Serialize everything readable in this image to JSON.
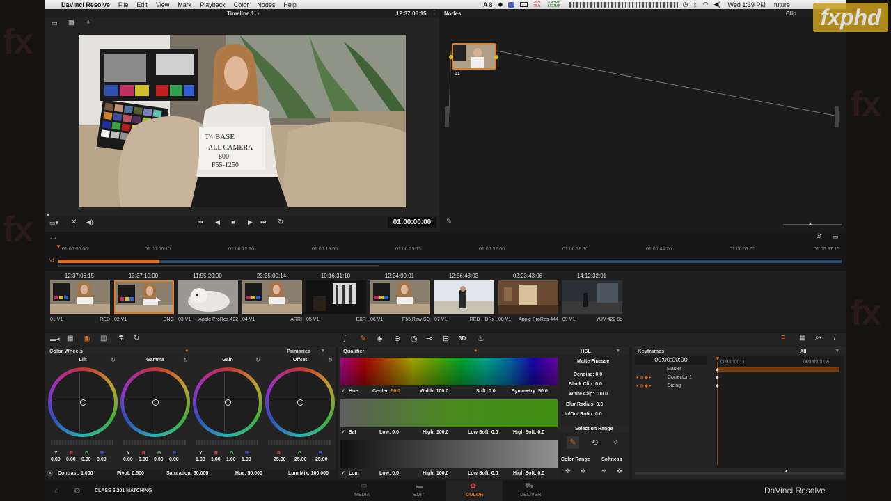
{
  "menubar": {
    "app_name": "DaVinci Resolve",
    "items": [
      "File",
      "Edit",
      "View",
      "Mark",
      "Playback",
      "Color",
      "Nodes",
      "Help"
    ],
    "tray_count": "8",
    "net_up": "0B/s 0B/s",
    "net_traffic": "7043MB 8327MB",
    "clock": "Wed 1:39 PM",
    "user": "future"
  },
  "viewer": {
    "timeline_name": "Timeline 1",
    "source_timecode": "12:37:06:15",
    "record_timecode": "01:00:00:00"
  },
  "nodes": {
    "title": "Nodes",
    "mode": "Clip",
    "node_label": "01"
  },
  "timeline": {
    "track": "V1",
    "ruler": [
      "01:00:00:00",
      "01:00:06:10",
      "01:00:12:20",
      "01:00:19:05",
      "01:00:25:15",
      "01:00:32:00",
      "01:00:38:10",
      "01:00:44:20",
      "01:00:51:05",
      "01:00:57:15"
    ]
  },
  "clips": [
    {
      "tc": "12:37:06:15",
      "num": "01",
      "track": "V1",
      "codec": "RED",
      "selected": false,
      "scene": "chart"
    },
    {
      "tc": "13:37:10:00",
      "num": "02",
      "track": "V1",
      "codec": "DNG",
      "selected": true,
      "scene": "chart"
    },
    {
      "tc": "11:55:20:00",
      "num": "03",
      "track": "V1",
      "codec": "Apple ProRes 422",
      "selected": false,
      "scene": "dog"
    },
    {
      "tc": "23:35:00:14",
      "num": "04",
      "track": "V1",
      "codec": "ARRI",
      "selected": false,
      "scene": "chart"
    },
    {
      "tc": "10:16:31:10",
      "num": "05",
      "track": "V1",
      "codec": "EXR",
      "selected": false,
      "scene": "dark"
    },
    {
      "tc": "12:34:09:01",
      "num": "06",
      "track": "V1",
      "codec": "F55 Raw SQ",
      "selected": false,
      "scene": "chart"
    },
    {
      "tc": "12:56:43:03",
      "num": "07",
      "track": "V1",
      "codec": "RED HDRx",
      "selected": false,
      "scene": "beach"
    },
    {
      "tc": "02:23:43:06",
      "num": "08",
      "track": "V1",
      "codec": "Apple ProRes 444",
      "selected": false,
      "scene": "room"
    },
    {
      "tc": "14:12:32:01",
      "num": "09",
      "track": "V1",
      "codec": "YUV 422 8b",
      "selected": false,
      "scene": "street"
    }
  ],
  "toolbar": {
    "label_3d": "3D"
  },
  "wheels": {
    "title": "Color Wheels",
    "mode": "Primaries",
    "items": [
      {
        "name": "Lift",
        "values": [
          {
            "k": "Y",
            "v": "0.00"
          },
          {
            "k": "R",
            "v": "0.00"
          },
          {
            "k": "G",
            "v": "0.00"
          },
          {
            "k": "B",
            "v": "0.00"
          }
        ]
      },
      {
        "name": "Gamma",
        "values": [
          {
            "k": "Y",
            "v": "0.00"
          },
          {
            "k": "R",
            "v": "0.00"
          },
          {
            "k": "G",
            "v": "0.00"
          },
          {
            "k": "B",
            "v": "0.00"
          }
        ]
      },
      {
        "name": "Gain",
        "values": [
          {
            "k": "Y",
            "v": "1.00"
          },
          {
            "k": "R",
            "v": "1.00"
          },
          {
            "k": "G",
            "v": "1.00"
          },
          {
            "k": "B",
            "v": "1.00"
          }
        ]
      },
      {
        "name": "Offset",
        "values": [
          {
            "k": "R",
            "v": "25.00"
          },
          {
            "k": "G",
            "v": "25.00"
          },
          {
            "k": "B",
            "v": "25.00"
          }
        ]
      }
    ],
    "footer": {
      "contrast": "Contrast: 1.000",
      "pivot": "Pivot: 0.500",
      "saturation": "Saturation: 50.000",
      "hue": "Hue: 50.000",
      "lum_mix": "Lum Mix: 100.000"
    }
  },
  "qualifier": {
    "title": "Qualifier",
    "mode": "HSL",
    "hue": {
      "label": "Hue",
      "center_label": "Center: ",
      "center": "50.0",
      "width": "Width: 100.0",
      "soft": "Soft: 0.0",
      "symmetry": "Symmetry: 50.0"
    },
    "sat": {
      "label": "Sat",
      "low": "Low: 0.0",
      "high": "High: 100.0",
      "low_soft": "Low Soft: 0.0",
      "high_soft": "High Soft: 0.0"
    },
    "lum": {
      "label": "Lum",
      "low": "Low: 0.0",
      "high": "High: 100.0",
      "low_soft": "Low Soft: 0.0",
      "high_soft": "High Soft: 0.0"
    }
  },
  "matte": {
    "title": "Matte Finesse",
    "denoise": "Denoise:  0.0",
    "black_clip": "Black Clip:  0.0",
    "white_clip": "White Clip:  100.0",
    "blur_radius": "Blur Radius:  0.0",
    "in_out_ratio": "In/Out Ratio:  0.0",
    "selection_range": "Selection Range",
    "color_range": "Color Range",
    "softness": "Softness"
  },
  "keyframes": {
    "title": "Keyframes",
    "filter": "All",
    "timecode": "00:00:00:00",
    "ruler_start": "00:00:00:00",
    "ruler_end": "00:00:05:08",
    "tracks": [
      "Master",
      "Corrector 1",
      "Sizing"
    ]
  },
  "bottom": {
    "project": "CLASS 6 201 MATCHING",
    "pages": [
      "MEDIA",
      "EDIT",
      "COLOR",
      "DELIVER"
    ],
    "brand": "DaVinci Resolve"
  },
  "colors": {
    "accent": "#e07020",
    "track": "#2a4a6a"
  }
}
